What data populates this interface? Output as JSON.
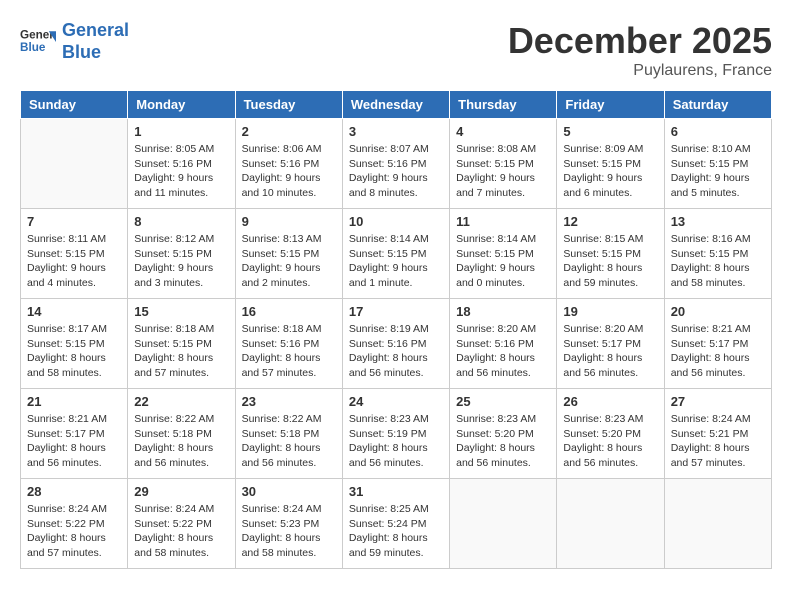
{
  "header": {
    "logo_line1": "General",
    "logo_line2": "Blue",
    "month": "December 2025",
    "location": "Puylaurens, France"
  },
  "weekdays": [
    "Sunday",
    "Monday",
    "Tuesday",
    "Wednesday",
    "Thursday",
    "Friday",
    "Saturday"
  ],
  "weeks": [
    [
      {
        "date": "",
        "sunrise": "",
        "sunset": "",
        "daylight": ""
      },
      {
        "date": "1",
        "sunrise": "8:05 AM",
        "sunset": "5:16 PM",
        "daylight": "9 hours and 11 minutes."
      },
      {
        "date": "2",
        "sunrise": "8:06 AM",
        "sunset": "5:16 PM",
        "daylight": "9 hours and 10 minutes."
      },
      {
        "date": "3",
        "sunrise": "8:07 AM",
        "sunset": "5:16 PM",
        "daylight": "9 hours and 8 minutes."
      },
      {
        "date": "4",
        "sunrise": "8:08 AM",
        "sunset": "5:15 PM",
        "daylight": "9 hours and 7 minutes."
      },
      {
        "date": "5",
        "sunrise": "8:09 AM",
        "sunset": "5:15 PM",
        "daylight": "9 hours and 6 minutes."
      },
      {
        "date": "6",
        "sunrise": "8:10 AM",
        "sunset": "5:15 PM",
        "daylight": "9 hours and 5 minutes."
      }
    ],
    [
      {
        "date": "7",
        "sunrise": "8:11 AM",
        "sunset": "5:15 PM",
        "daylight": "9 hours and 4 minutes."
      },
      {
        "date": "8",
        "sunrise": "8:12 AM",
        "sunset": "5:15 PM",
        "daylight": "9 hours and 3 minutes."
      },
      {
        "date": "9",
        "sunrise": "8:13 AM",
        "sunset": "5:15 PM",
        "daylight": "9 hours and 2 minutes."
      },
      {
        "date": "10",
        "sunrise": "8:14 AM",
        "sunset": "5:15 PM",
        "daylight": "9 hours and 1 minute."
      },
      {
        "date": "11",
        "sunrise": "8:14 AM",
        "sunset": "5:15 PM",
        "daylight": "9 hours and 0 minutes."
      },
      {
        "date": "12",
        "sunrise": "8:15 AM",
        "sunset": "5:15 PM",
        "daylight": "8 hours and 59 minutes."
      },
      {
        "date": "13",
        "sunrise": "8:16 AM",
        "sunset": "5:15 PM",
        "daylight": "8 hours and 58 minutes."
      }
    ],
    [
      {
        "date": "14",
        "sunrise": "8:17 AM",
        "sunset": "5:15 PM",
        "daylight": "8 hours and 58 minutes."
      },
      {
        "date": "15",
        "sunrise": "8:18 AM",
        "sunset": "5:15 PM",
        "daylight": "8 hours and 57 minutes."
      },
      {
        "date": "16",
        "sunrise": "8:18 AM",
        "sunset": "5:16 PM",
        "daylight": "8 hours and 57 minutes."
      },
      {
        "date": "17",
        "sunrise": "8:19 AM",
        "sunset": "5:16 PM",
        "daylight": "8 hours and 56 minutes."
      },
      {
        "date": "18",
        "sunrise": "8:20 AM",
        "sunset": "5:16 PM",
        "daylight": "8 hours and 56 minutes."
      },
      {
        "date": "19",
        "sunrise": "8:20 AM",
        "sunset": "5:17 PM",
        "daylight": "8 hours and 56 minutes."
      },
      {
        "date": "20",
        "sunrise": "8:21 AM",
        "sunset": "5:17 PM",
        "daylight": "8 hours and 56 minutes."
      }
    ],
    [
      {
        "date": "21",
        "sunrise": "8:21 AM",
        "sunset": "5:17 PM",
        "daylight": "8 hours and 56 minutes."
      },
      {
        "date": "22",
        "sunrise": "8:22 AM",
        "sunset": "5:18 PM",
        "daylight": "8 hours and 56 minutes."
      },
      {
        "date": "23",
        "sunrise": "8:22 AM",
        "sunset": "5:18 PM",
        "daylight": "8 hours and 56 minutes."
      },
      {
        "date": "24",
        "sunrise": "8:23 AM",
        "sunset": "5:19 PM",
        "daylight": "8 hours and 56 minutes."
      },
      {
        "date": "25",
        "sunrise": "8:23 AM",
        "sunset": "5:20 PM",
        "daylight": "8 hours and 56 minutes."
      },
      {
        "date": "26",
        "sunrise": "8:23 AM",
        "sunset": "5:20 PM",
        "daylight": "8 hours and 56 minutes."
      },
      {
        "date": "27",
        "sunrise": "8:24 AM",
        "sunset": "5:21 PM",
        "daylight": "8 hours and 57 minutes."
      }
    ],
    [
      {
        "date": "28",
        "sunrise": "8:24 AM",
        "sunset": "5:22 PM",
        "daylight": "8 hours and 57 minutes."
      },
      {
        "date": "29",
        "sunrise": "8:24 AM",
        "sunset": "5:22 PM",
        "daylight": "8 hours and 58 minutes."
      },
      {
        "date": "30",
        "sunrise": "8:24 AM",
        "sunset": "5:23 PM",
        "daylight": "8 hours and 58 minutes."
      },
      {
        "date": "31",
        "sunrise": "8:25 AM",
        "sunset": "5:24 PM",
        "daylight": "8 hours and 59 minutes."
      },
      {
        "date": "",
        "sunrise": "",
        "sunset": "",
        "daylight": ""
      },
      {
        "date": "",
        "sunrise": "",
        "sunset": "",
        "daylight": ""
      },
      {
        "date": "",
        "sunrise": "",
        "sunset": "",
        "daylight": ""
      }
    ]
  ]
}
